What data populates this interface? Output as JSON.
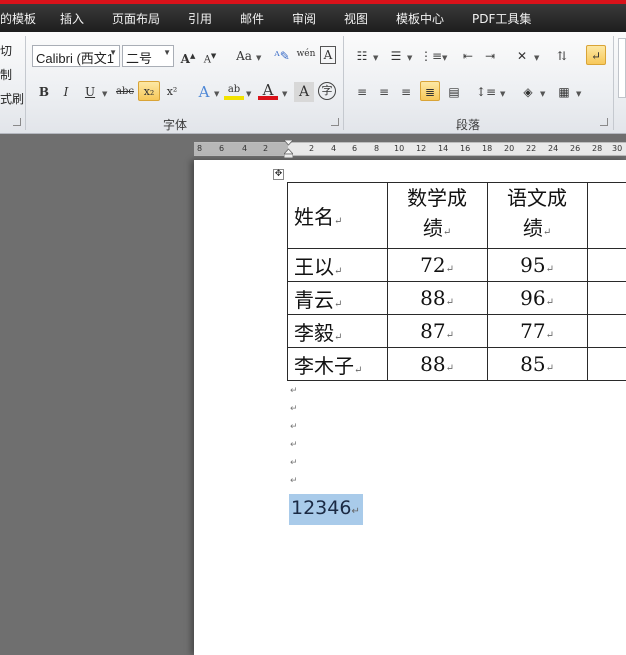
{
  "menu": {
    "items": [
      "的模板",
      "插入",
      "页面布局",
      "引用",
      "邮件",
      "审阅",
      "视图",
      "模板中心",
      "PDF工具集"
    ]
  },
  "clipboard": {
    "items": [
      "切",
      "制",
      "式刷"
    ]
  },
  "font_group": {
    "font_name": "Calibri (西文1",
    "font_size": "二号",
    "label": "字体",
    "grow": "A",
    "shrink": "A",
    "change_case": "Aa",
    "bold": "B",
    "italic": "I",
    "underline": "U",
    "strikethrough": "abc",
    "subscript": "x₂",
    "superscript": "x²",
    "text_effect": "A",
    "highlight": "ab",
    "font_color": "A",
    "char_shading": "A",
    "enclose_char": "字",
    "phonetic": "wén"
  },
  "paragraph_group": {
    "label": "段落"
  },
  "ruler": {
    "ticks": [
      "8",
      "6",
      "4",
      "2",
      "",
      "2",
      "4",
      "6",
      "8",
      "10",
      "12",
      "14",
      "16",
      "18",
      "20",
      "22",
      "24",
      "26",
      "28",
      "30"
    ]
  },
  "table": {
    "header": [
      "姓名",
      "数学成\n绩",
      "语文成\n绩"
    ],
    "rows": [
      [
        "王以",
        "72",
        "95"
      ],
      [
        "青云",
        "88",
        "96"
      ],
      [
        "李毅",
        "87",
        "77"
      ],
      [
        "李木子",
        "88",
        "85"
      ]
    ]
  },
  "document": {
    "selected_text": "12346"
  },
  "colors": {
    "accent_red": "#d9121a",
    "highlight_yellow": "#f7c85a",
    "selection_blue": "#a9cbea"
  }
}
